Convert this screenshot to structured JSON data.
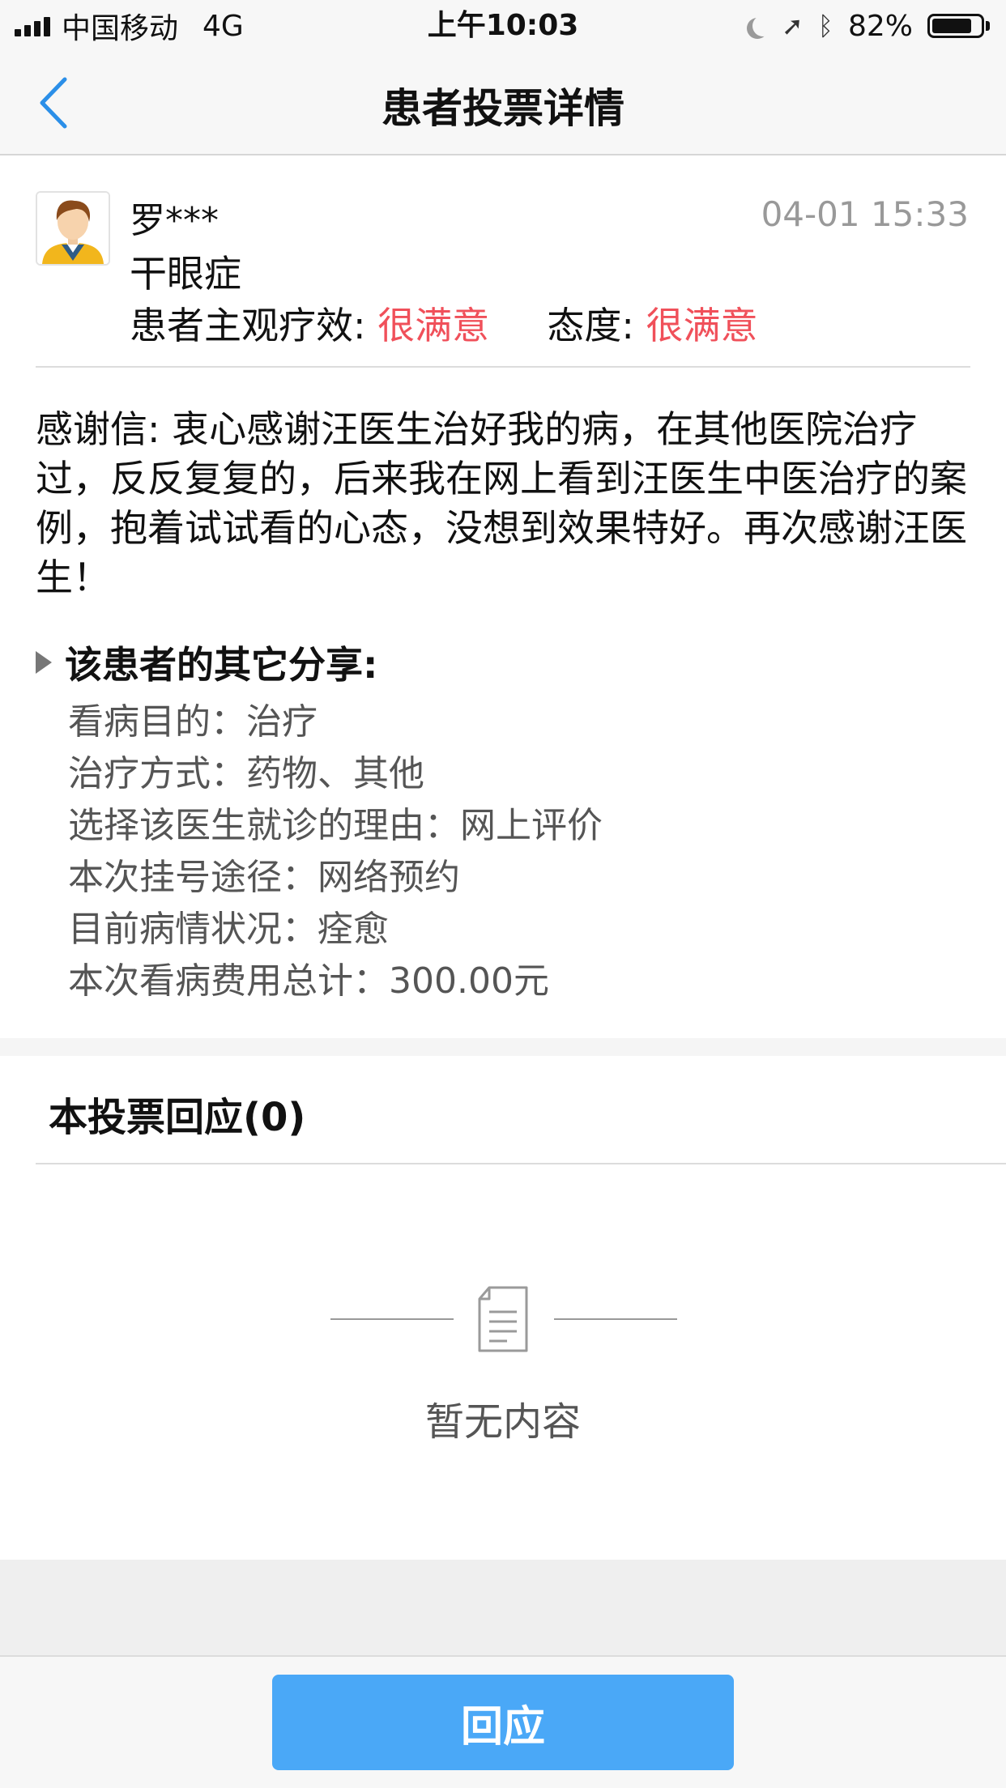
{
  "status_bar": {
    "carrier": "中国移动",
    "network": "4G",
    "time": "上午10:03",
    "battery": "82%",
    "battery_level": 0.82
  },
  "nav": {
    "title": "患者投票详情",
    "back_icon": "chevron-left-icon"
  },
  "review": {
    "patient_name": "罗***",
    "timestamp": "04-01 15:33",
    "condition": "干眼症",
    "effect_label": "患者主观疗效:",
    "effect_value": "很满意",
    "attitude_label": "态度:",
    "attitude_value": "很满意",
    "rating_color": "#f0505a",
    "thanks_letter": "感谢信: 衷心感谢汪医生治好我的病，在其他医院治疗过，反反复复的，后来我在网上看到汪医生中医治疗的案例，抱着试试看的心态，没想到效果特好。再次感谢汪医生！"
  },
  "share": {
    "header": "该患者的其它分享:",
    "items": [
      "看病目的：治疗",
      "治疗方式：药物、其他",
      "选择该医生就诊的理由：网上评价",
      "本次挂号途径：网络预约",
      "目前病情状况：痊愈",
      "本次看病费用总计：300.00元"
    ]
  },
  "responses": {
    "title": "本投票回应(0)",
    "empty_text": "暂无内容",
    "empty_icon": "document-icon"
  },
  "footer": {
    "reply_label": "回应",
    "button_color": "#4aa8f7"
  }
}
